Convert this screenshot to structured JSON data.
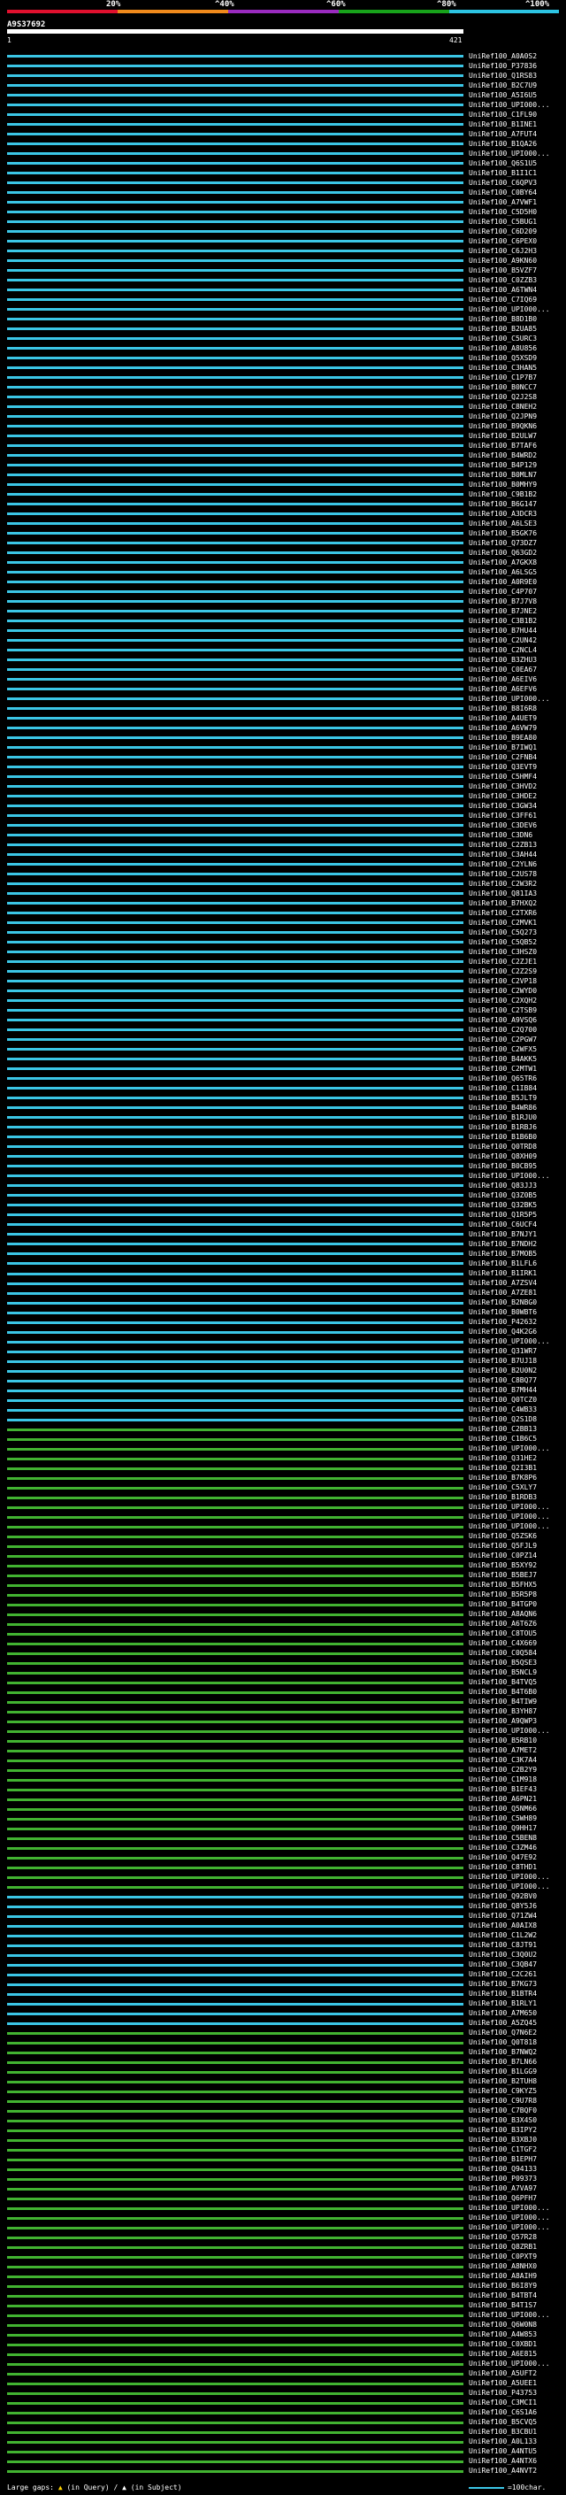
{
  "header": {
    "legend_colors": [
      "#e0102e",
      "#f08a1c",
      "#9a2bbf",
      "#18a31b",
      "#2dc4e3"
    ],
    "percent_labels": [
      "20%",
      "^40%",
      "^60%",
      "^80%",
      "^100%"
    ],
    "query_id": "A9S37692",
    "query_start": "1",
    "query_end": "421"
  },
  "hits": [
    {
      "label": "UniRef100_A0A0S2",
      "color": "#3bc6e6"
    },
    {
      "label": "UniRef100_P37836",
      "color": "#3bc6e6"
    },
    {
      "label": "UniRef100_Q1RS83",
      "color": "#3bc6e6"
    },
    {
      "label": "UniRef100_B2C7U9",
      "color": "#3bc6e6"
    },
    {
      "label": "UniRef100_A5I6U5",
      "color": "#3bc6e6"
    },
    {
      "label": "UniRef100_UPI000...",
      "color": "#3bc6e6"
    },
    {
      "label": "UniRef100_C1FL90",
      "color": "#3bc6e6"
    },
    {
      "label": "UniRef100_B1INE1",
      "color": "#3bc6e6"
    },
    {
      "label": "UniRef100_A7FUT4",
      "color": "#3bc6e6"
    },
    {
      "label": "UniRef100_B1QA26",
      "color": "#3bc6e6"
    },
    {
      "label": "UniRef100_UPI000...",
      "color": "#3bc6e6"
    },
    {
      "label": "UniRef100_Q6S1U5",
      "color": "#3bc6e6"
    },
    {
      "label": "UniRef100_B1I1C1",
      "color": "#3bc6e6"
    },
    {
      "label": "UniRef100_C6QPV3",
      "color": "#3bc6e6"
    },
    {
      "label": "UniRef100_C0BY64",
      "color": "#3bc6e6"
    },
    {
      "label": "UniRef100_A7VWF1",
      "color": "#3bc6e6"
    },
    {
      "label": "UniRef100_C5D5H0",
      "color": "#3bc6e6"
    },
    {
      "label": "UniRef100_C5BUG1",
      "color": "#3bc6e6"
    },
    {
      "label": "UniRef100_C6D209",
      "color": "#3bc6e6"
    },
    {
      "label": "UniRef100_C6PEX0",
      "color": "#3bc6e6"
    },
    {
      "label": "UniRef100_C6J2H3",
      "color": "#3bc6e6"
    },
    {
      "label": "UniRef100_A9KN60",
      "color": "#3bc6e6"
    },
    {
      "label": "UniRef100_B5VZF7",
      "color": "#3bc6e6"
    },
    {
      "label": "UniRef100_C0ZZB3",
      "color": "#3bc6e6"
    },
    {
      "label": "UniRef100_A6TWN4",
      "color": "#3bc6e6"
    },
    {
      "label": "UniRef100_C7IQ69",
      "color": "#3bc6e6"
    },
    {
      "label": "UniRef100_UPI000...",
      "color": "#3bc6e6"
    },
    {
      "label": "UniRef100_B8D1B0",
      "color": "#3bc6e6"
    },
    {
      "label": "UniRef100_B2UA85",
      "color": "#3bc6e6"
    },
    {
      "label": "UniRef100_C5URC3",
      "color": "#3bc6e6"
    },
    {
      "label": "UniRef100_A8U856",
      "color": "#3bc6e6"
    },
    {
      "label": "UniRef100_Q5XSD9",
      "color": "#3bc6e6"
    },
    {
      "label": "UniRef100_C3HAN5",
      "color": "#3bc6e6"
    },
    {
      "label": "UniRef100_C1P7B7",
      "color": "#3bc6e6"
    },
    {
      "label": "UniRef100_B0NCC7",
      "color": "#3bc6e6"
    },
    {
      "label": "UniRef100_Q2J2S8",
      "color": "#3bc6e6"
    },
    {
      "label": "UniRef100_C8NEH2",
      "color": "#3bc6e6"
    },
    {
      "label": "UniRef100_Q2JPN9",
      "color": "#3bc6e6"
    },
    {
      "label": "UniRef100_B9QKN6",
      "color": "#3bc6e6"
    },
    {
      "label": "UniRef100_B2ULW7",
      "color": "#3bc6e6"
    },
    {
      "label": "UniRef100_B7TAF6",
      "color": "#3bc6e6"
    },
    {
      "label": "UniRef100_B4WRD2",
      "color": "#3bc6e6"
    },
    {
      "label": "UniRef100_B4P129",
      "color": "#3bc6e6"
    },
    {
      "label": "UniRef100_B0MLN7",
      "color": "#3bc6e6"
    },
    {
      "label": "UniRef100_B0MHY9",
      "color": "#3bc6e6"
    },
    {
      "label": "UniRef100_C9B1B2",
      "color": "#3bc6e6"
    },
    {
      "label": "UniRef100_B6G147",
      "color": "#3bc6e6"
    },
    {
      "label": "UniRef100_A3DCR3",
      "color": "#3bc6e6"
    },
    {
      "label": "UniRef100_A6LSE3",
      "color": "#3bc6e6"
    },
    {
      "label": "UniRef100_B5GK76",
      "color": "#3bc6e6"
    },
    {
      "label": "UniRef100_Q73DZ7",
      "color": "#3bc6e6"
    },
    {
      "label": "UniRef100_Q63GD2",
      "color": "#3bc6e6"
    },
    {
      "label": "UniRef100_A7GKX8",
      "color": "#3bc6e6"
    },
    {
      "label": "UniRef100_A6LSG5",
      "color": "#3bc6e6"
    },
    {
      "label": "UniRef100_A0R9E0",
      "color": "#3bc6e6"
    },
    {
      "label": "UniRef100_C4P707",
      "color": "#3bc6e6"
    },
    {
      "label": "UniRef100_B7J7V8",
      "color": "#3bc6e6"
    },
    {
      "label": "UniRef100_B7JNE2",
      "color": "#3bc6e6"
    },
    {
      "label": "UniRef100_C3B1B2",
      "color": "#3bc6e6"
    },
    {
      "label": "UniRef100_B7HU44",
      "color": "#3bc6e6"
    },
    {
      "label": "UniRef100_C2UN42",
      "color": "#3bc6e6"
    },
    {
      "label": "UniRef100_C2NCL4",
      "color": "#3bc6e6"
    },
    {
      "label": "UniRef100_B3ZHU3",
      "color": "#3bc6e6"
    },
    {
      "label": "UniRef100_C0EA67",
      "color": "#3bc6e6"
    },
    {
      "label": "UniRef100_A6EIV6",
      "color": "#3bc6e6"
    },
    {
      "label": "UniRef100_A6EFV6",
      "color": "#3bc6e6"
    },
    {
      "label": "UniRef100_UPI000...",
      "color": "#3bc6e6"
    },
    {
      "label": "UniRef100_B8I6R8",
      "color": "#3bc6e6"
    },
    {
      "label": "UniRef100_A4UET9",
      "color": "#3bc6e6"
    },
    {
      "label": "UniRef100_A6VW79",
      "color": "#3bc6e6"
    },
    {
      "label": "UniRef100_B9EA80",
      "color": "#3bc6e6"
    },
    {
      "label": "UniRef100_B7IWQ1",
      "color": "#3bc6e6"
    },
    {
      "label": "UniRef100_C2FNB4",
      "color": "#3bc6e6"
    },
    {
      "label": "UniRef100_Q3EVT9",
      "color": "#3bc6e6"
    },
    {
      "label": "UniRef100_C5HMF4",
      "color": "#3bc6e6"
    },
    {
      "label": "UniRef100_C3HVD2",
      "color": "#3bc6e6"
    },
    {
      "label": "UniRef100_C3HDE2",
      "color": "#3bc6e6"
    },
    {
      "label": "UniRef100_C3GW34",
      "color": "#3bc6e6"
    },
    {
      "label": "UniRef100_C3FF61",
      "color": "#3bc6e6"
    },
    {
      "label": "UniRef100_C3DEV6",
      "color": "#3bc6e6"
    },
    {
      "label": "UniRef100_C3DN6",
      "color": "#3bc6e6"
    },
    {
      "label": "UniRef100_C2ZB13",
      "color": "#3bc6e6"
    },
    {
      "label": "UniRef100_C3AH44",
      "color": "#3bc6e6"
    },
    {
      "label": "UniRef100_C2YLN6",
      "color": "#3bc6e6"
    },
    {
      "label": "UniRef100_C2US78",
      "color": "#3bc6e6"
    },
    {
      "label": "UniRef100_C2W3R2",
      "color": "#3bc6e6"
    },
    {
      "label": "UniRef100_Q81IA3",
      "color": "#3bc6e6"
    },
    {
      "label": "UniRef100_B7HXQ2",
      "color": "#3bc6e6"
    },
    {
      "label": "UniRef100_C2TXR6",
      "color": "#3bc6e6"
    },
    {
      "label": "UniRef100_C2MVK1",
      "color": "#3bc6e6"
    },
    {
      "label": "UniRef100_C5Q273",
      "color": "#3bc6e6"
    },
    {
      "label": "UniRef100_C5QB52",
      "color": "#3bc6e6"
    },
    {
      "label": "UniRef100_C3HSZ0",
      "color": "#3bc6e6"
    },
    {
      "label": "UniRef100_C2ZJE1",
      "color": "#3bc6e6"
    },
    {
      "label": "UniRef100_C2Z2S9",
      "color": "#3bc6e6"
    },
    {
      "label": "UniRef100_C2VP18",
      "color": "#3bc6e6"
    },
    {
      "label": "UniRef100_C2WYD0",
      "color": "#3bc6e6"
    },
    {
      "label": "UniRef100_C2XQH2",
      "color": "#3bc6e6"
    },
    {
      "label": "UniRef100_C2TSB9",
      "color": "#3bc6e6"
    },
    {
      "label": "UniRef100_A9VSQ6",
      "color": "#3bc6e6"
    },
    {
      "label": "UniRef100_C2Q700",
      "color": "#3bc6e6"
    },
    {
      "label": "UniRef100_C2PGW7",
      "color": "#3bc6e6"
    },
    {
      "label": "UniRef100_C2WFX5",
      "color": "#3bc6e6"
    },
    {
      "label": "UniRef100_B4AKK5",
      "color": "#3bc6e6"
    },
    {
      "label": "UniRef100_C2MTW1",
      "color": "#3bc6e6"
    },
    {
      "label": "UniRef100_Q65TR6",
      "color": "#3bc6e6"
    },
    {
      "label": "UniRef100_C1IB84",
      "color": "#3bc6e6"
    },
    {
      "label": "UniRef100_B5JLT9",
      "color": "#3bc6e6"
    },
    {
      "label": "UniRef100_B4WR86",
      "color": "#3bc6e6"
    },
    {
      "label": "UniRef100_B1RJU0",
      "color": "#3bc6e6"
    },
    {
      "label": "UniRef100_B1RBJ6",
      "color": "#3bc6e6"
    },
    {
      "label": "UniRef100_B1B6B0",
      "color": "#3bc6e6"
    },
    {
      "label": "UniRef100_Q0TRD8",
      "color": "#3bc6e6"
    },
    {
      "label": "UniRef100_Q8XH09",
      "color": "#3bc6e6"
    },
    {
      "label": "UniRef100_B0CB95",
      "color": "#3bc6e6"
    },
    {
      "label": "UniRef100_UPI000...",
      "color": "#3bc6e6"
    },
    {
      "label": "UniRef100_Q83JJ3",
      "color": "#3bc6e6"
    },
    {
      "label": "UniRef100_Q3Z0B5",
      "color": "#3bc6e6"
    },
    {
      "label": "UniRef100_Q32BK5",
      "color": "#3bc6e6"
    },
    {
      "label": "UniRef100_Q1R5P5",
      "color": "#3bc6e6"
    },
    {
      "label": "UniRef100_C6UCF4",
      "color": "#3bc6e6"
    },
    {
      "label": "UniRef100_B7NJY1",
      "color": "#3bc6e6"
    },
    {
      "label": "UniRef100_B7NDH2",
      "color": "#3bc6e6"
    },
    {
      "label": "UniRef100_B7MOB5",
      "color": "#3bc6e6"
    },
    {
      "label": "UniRef100_B1LFL6",
      "color": "#3bc6e6"
    },
    {
      "label": "UniRef100_B1IRK1",
      "color": "#3bc6e6"
    },
    {
      "label": "UniRef100_A7ZSV4",
      "color": "#3bc6e6"
    },
    {
      "label": "UniRef100_A7ZE81",
      "color": "#3bc6e6"
    },
    {
      "label": "UniRef100_B2NBG0",
      "color": "#3bc6e6"
    },
    {
      "label": "UniRef100_B0WBT6",
      "color": "#3bc6e6"
    },
    {
      "label": "UniRef100_P42632",
      "color": "#3bc6e6"
    },
    {
      "label": "UniRef100_Q4K2G6",
      "color": "#3bc6e6"
    },
    {
      "label": "UniRef100_UPI000...",
      "color": "#3bc6e6"
    },
    {
      "label": "UniRef100_Q31WR7",
      "color": "#3bc6e6"
    },
    {
      "label": "UniRef100_B7UJ18",
      "color": "#3bc6e6"
    },
    {
      "label": "UniRef100_B2U0N2",
      "color": "#3bc6e6"
    },
    {
      "label": "UniRef100_C8BQ77",
      "color": "#3bc6e6"
    },
    {
      "label": "UniRef100_B7MH44",
      "color": "#3bc6e6"
    },
    {
      "label": "UniRef100_Q0TCZ0",
      "color": "#3bc6e6"
    },
    {
      "label": "UniRef100_C4WB33",
      "color": "#3bc6e6"
    },
    {
      "label": "UniRef100_Q2S1D8",
      "color": "#3bc6e6"
    },
    {
      "label": "UniRef100_C2BB13",
      "color": "#42b331"
    },
    {
      "label": "UniRef100_C1B6C5",
      "color": "#42b331"
    },
    {
      "label": "UniRef100_UPI000...",
      "color": "#42b331"
    },
    {
      "label": "UniRef100_Q31HE2",
      "color": "#42b331"
    },
    {
      "label": "UniRef100_Q2I3B1",
      "color": "#42b331"
    },
    {
      "label": "UniRef100_B7K8P6",
      "color": "#42b331"
    },
    {
      "label": "UniRef100_C5XLY7",
      "color": "#42b331"
    },
    {
      "label": "UniRef100_B1RDB3",
      "color": "#42b331"
    },
    {
      "label": "UniRef100_UPI000...",
      "color": "#42b331"
    },
    {
      "label": "UniRef100_UPI000...",
      "color": "#42b331"
    },
    {
      "label": "UniRef100_UPI000...",
      "color": "#42b331"
    },
    {
      "label": "UniRef100_Q5ZSK6",
      "color": "#42b331"
    },
    {
      "label": "UniRef100_Q5FJL9",
      "color": "#42b331"
    },
    {
      "label": "UniRef100_C0PZ14",
      "color": "#42b331"
    },
    {
      "label": "UniRef100_B5XY92",
      "color": "#42b331"
    },
    {
      "label": "UniRef100_B5BEJ7",
      "color": "#42b331"
    },
    {
      "label": "UniRef100_B5FHX5",
      "color": "#42b331"
    },
    {
      "label": "UniRef100_B5R5P8",
      "color": "#42b331"
    },
    {
      "label": "UniRef100_B4TGP0",
      "color": "#42b331"
    },
    {
      "label": "UniRef100_A8AQN6",
      "color": "#42b331"
    },
    {
      "label": "UniRef100_A6T6Z6",
      "color": "#42b331"
    },
    {
      "label": "UniRef100_C8TOU5",
      "color": "#42b331"
    },
    {
      "label": "UniRef100_C4X669",
      "color": "#42b331"
    },
    {
      "label": "UniRef100_C0Q584",
      "color": "#42b331"
    },
    {
      "label": "UniRef100_B5QSE3",
      "color": "#42b331"
    },
    {
      "label": "UniRef100_B5NCL9",
      "color": "#42b331"
    },
    {
      "label": "UniRef100_B4TVQ5",
      "color": "#42b331"
    },
    {
      "label": "UniRef100_B4T6B0",
      "color": "#42b331"
    },
    {
      "label": "UniRef100_B4TIW9",
      "color": "#42b331"
    },
    {
      "label": "UniRef100_B3YH87",
      "color": "#42b331"
    },
    {
      "label": "UniRef100_A9QWP3",
      "color": "#42b331"
    },
    {
      "label": "UniRef100_UPI000...",
      "color": "#42b331"
    },
    {
      "label": "UniRef100_B5RB10",
      "color": "#42b331"
    },
    {
      "label": "UniRef100_A7MET2",
      "color": "#42b331"
    },
    {
      "label": "UniRef100_C3K7A4",
      "color": "#42b331"
    },
    {
      "label": "UniRef100_C2B2Y9",
      "color": "#42b331"
    },
    {
      "label": "UniRef100_C1M918",
      "color": "#42b331"
    },
    {
      "label": "UniRef100_B1EF43",
      "color": "#42b331"
    },
    {
      "label": "UniRef100_A6PN21",
      "color": "#42b331"
    },
    {
      "label": "UniRef100_Q5NM66",
      "color": "#42b331"
    },
    {
      "label": "UniRef100_C5WH89",
      "color": "#42b331"
    },
    {
      "label": "UniRef100_Q9HH17",
      "color": "#42b331"
    },
    {
      "label": "UniRef100_C5BEN8",
      "color": "#42b331"
    },
    {
      "label": "UniRef100_C3ZM46",
      "color": "#42b331"
    },
    {
      "label": "UniRef100_Q47E92",
      "color": "#42b331"
    },
    {
      "label": "UniRef100_C8THD1",
      "color": "#42b331"
    },
    {
      "label": "UniRef100_UPI000...",
      "color": "#42b331"
    },
    {
      "label": "UniRef100_UPI000...",
      "color": "#42b331"
    },
    {
      "label": "UniRef100_Q92BV0",
      "color": "#3bc6e6"
    },
    {
      "label": "UniRef100_Q8Y5J6",
      "color": "#3bc6e6"
    },
    {
      "label": "UniRef100_Q71ZW4",
      "color": "#3bc6e6"
    },
    {
      "label": "UniRef100_A0AIX8",
      "color": "#3bc6e6"
    },
    {
      "label": "UniRef100_C1L2W2",
      "color": "#3bc6e6"
    },
    {
      "label": "UniRef100_C8JT91",
      "color": "#3bc6e6"
    },
    {
      "label": "UniRef100_C3Q0U2",
      "color": "#3bc6e6"
    },
    {
      "label": "UniRef100_C3QB47",
      "color": "#3bc6e6"
    },
    {
      "label": "UniRef100_C2C261",
      "color": "#3bc6e6"
    },
    {
      "label": "UniRef100_B7KG73",
      "color": "#3bc6e6"
    },
    {
      "label": "UniRef100_B1BTR4",
      "color": "#3bc6e6"
    },
    {
      "label": "UniRef100_B1RLY1",
      "color": "#3bc6e6"
    },
    {
      "label": "UniRef100_A7M650",
      "color": "#3bc6e6"
    },
    {
      "label": "UniRef100_A5ZQ45",
      "color": "#3bc6e6"
    },
    {
      "label": "UniRef100_Q7N6E2",
      "color": "#42b331"
    },
    {
      "label": "UniRef100_Q0T818",
      "color": "#42b331"
    },
    {
      "label": "UniRef100_B7NWQ2",
      "color": "#42b331"
    },
    {
      "label": "UniRef100_B7LN66",
      "color": "#42b331"
    },
    {
      "label": "UniRef100_B1LGG9",
      "color": "#42b331"
    },
    {
      "label": "UniRef100_B2TUH8",
      "color": "#42b331"
    },
    {
      "label": "UniRef100_C9KYZ5",
      "color": "#42b331"
    },
    {
      "label": "UniRef100_C9U7R8",
      "color": "#42b331"
    },
    {
      "label": "UniRef100_C7BQF0",
      "color": "#42b331"
    },
    {
      "label": "UniRef100_B3X4S0",
      "color": "#42b331"
    },
    {
      "label": "UniRef100_B3IPY2",
      "color": "#42b331"
    },
    {
      "label": "UniRef100_B3XBJ0",
      "color": "#42b331"
    },
    {
      "label": "UniRef100_C1TGF2",
      "color": "#42b331"
    },
    {
      "label": "UniRef100_B1EPH7",
      "color": "#42b331"
    },
    {
      "label": "UniRef100_Q94133",
      "color": "#42b331"
    },
    {
      "label": "UniRef100_P09373",
      "color": "#42b331"
    },
    {
      "label": "UniRef100_A7VA97",
      "color": "#42b331"
    },
    {
      "label": "UniRef100_Q6PFH7",
      "color": "#42b331"
    },
    {
      "label": "UniRef100_UPI000...",
      "color": "#42b331"
    },
    {
      "label": "UniRef100_UPI000...",
      "color": "#42b331"
    },
    {
      "label": "UniRef100_UPI000...",
      "color": "#42b331"
    },
    {
      "label": "UniRef100_Q57R28",
      "color": "#42b331"
    },
    {
      "label": "UniRef100_Q8ZRB1",
      "color": "#42b331"
    },
    {
      "label": "UniRef100_C0PXT9",
      "color": "#42b331"
    },
    {
      "label": "UniRef100_A8NHX0",
      "color": "#42b331"
    },
    {
      "label": "UniRef100_A8AIH9",
      "color": "#42b331"
    },
    {
      "label": "UniRef100_B6I8Y9",
      "color": "#42b331"
    },
    {
      "label": "UniRef100_B4TBT4",
      "color": "#42b331"
    },
    {
      "label": "UniRef100_B4T1S7",
      "color": "#42b331"
    },
    {
      "label": "UniRef100_UPI000...",
      "color": "#42b331"
    },
    {
      "label": "UniRef100_Q6W0N8",
      "color": "#42b331"
    },
    {
      "label": "UniRef100_A4W853",
      "color": "#42b331"
    },
    {
      "label": "UniRef100_C0XBD1",
      "color": "#42b331"
    },
    {
      "label": "UniRef100_A6E815",
      "color": "#42b331"
    },
    {
      "label": "UniRef100_UPI000...",
      "color": "#42b331"
    },
    {
      "label": "UniRef100_A5UFT2",
      "color": "#42b331"
    },
    {
      "label": "UniRef100_A5UEE1",
      "color": "#42b331"
    },
    {
      "label": "UniRef100_P43753",
      "color": "#42b331"
    },
    {
      "label": "UniRef100_C3MCI1",
      "color": "#42b331"
    },
    {
      "label": "UniRef100_C6S1A6",
      "color": "#42b331"
    },
    {
      "label": "UniRef100_B5CVQ5",
      "color": "#42b331"
    },
    {
      "label": "UniRef100_B3CBU1",
      "color": "#42b331"
    },
    {
      "label": "UniRef100_A0L133",
      "color": "#42b331"
    },
    {
      "label": "UniRef100_A4NTU5",
      "color": "#42b331"
    },
    {
      "label": "UniRef100_A4NTX6",
      "color": "#42b331"
    },
    {
      "label": "UniRef100_A4NVT2",
      "color": "#42b331"
    }
  ],
  "footer": {
    "large_gaps": "Large gaps:",
    "query_marker": "(in Query)",
    "subject_marker": "(in Subject)",
    "scale_text": "=100char."
  }
}
